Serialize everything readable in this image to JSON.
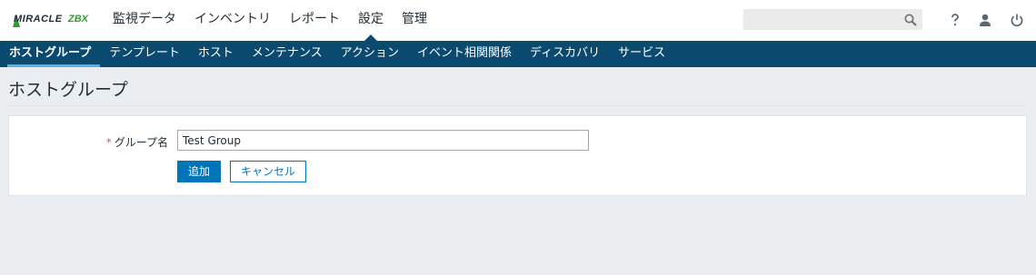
{
  "brand": {
    "name": "MIRACLE",
    "accent": "ZBX",
    "accent_color": "#2e9e2e"
  },
  "main_nav": [
    {
      "label": "監視データ"
    },
    {
      "label": "インベントリ"
    },
    {
      "label": "レポート"
    },
    {
      "label": "設定",
      "active": true
    },
    {
      "label": "管理"
    }
  ],
  "search": {
    "value": "",
    "placeholder": "",
    "icon": "search-icon"
  },
  "top_icons": [
    "help-icon",
    "user-icon",
    "power-icon"
  ],
  "sub_nav": [
    {
      "label": "ホストグループ",
      "active": true
    },
    {
      "label": "テンプレート"
    },
    {
      "label": "ホスト"
    },
    {
      "label": "メンテナンス"
    },
    {
      "label": "アクション"
    },
    {
      "label": "イベント相関関係"
    },
    {
      "label": "ディスカバリ"
    },
    {
      "label": "サービス"
    }
  ],
  "page": {
    "title": "ホストグループ"
  },
  "form": {
    "required_mark": "*",
    "group_name_label": "グループ名",
    "group_name_value": "Test Group",
    "add_button": "追加",
    "cancel_button": "キャンセル"
  },
  "colors": {
    "nav_bg": "#0b4a6f",
    "primary": "#0275b8",
    "page_bg": "#ebeef0",
    "required": "#e45959"
  }
}
